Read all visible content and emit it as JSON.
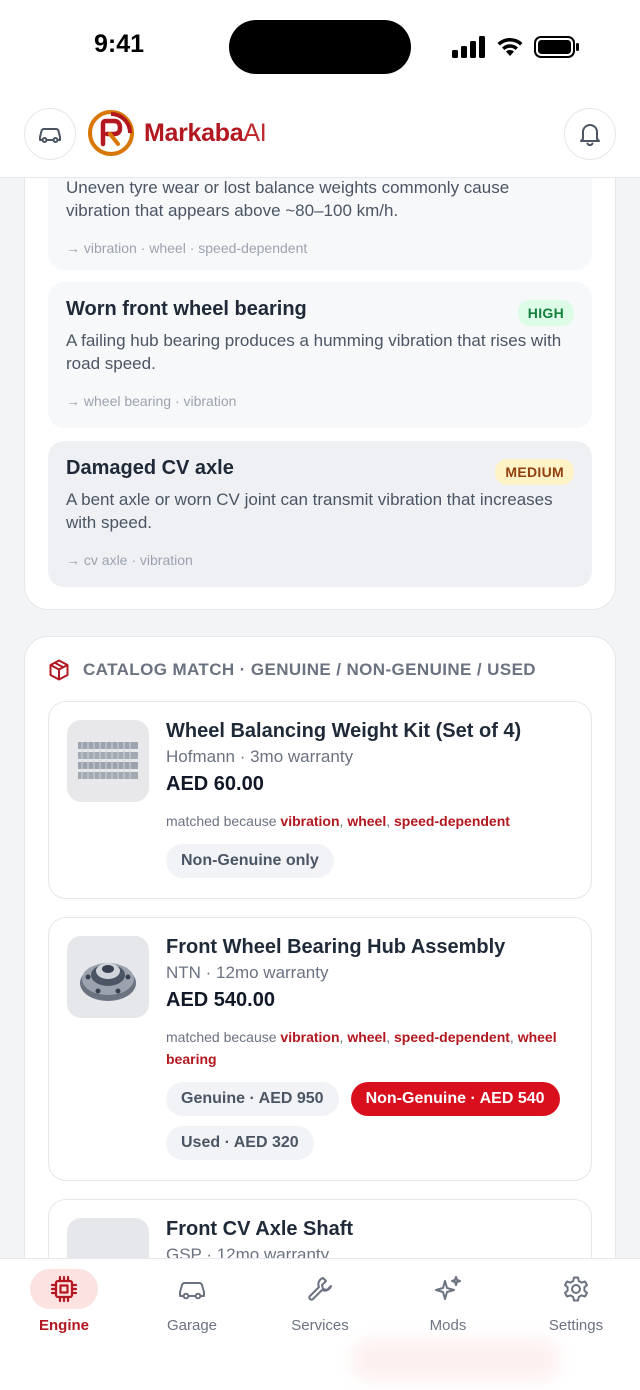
{
  "status_bar": {
    "time": "9:41"
  },
  "header": {
    "logo_main": "Markaba",
    "logo_ai": "AI"
  },
  "causes": [
    {
      "title": "",
      "description": "Uneven tyre wear or lost balance weights commonly cause vibration that appears above ~80–100 km/h.",
      "tags": "→ vibration · wheel · speed-dependent"
    },
    {
      "title": "Worn front wheel bearing",
      "severity": "HIGH",
      "severity_color": "#15803d",
      "severity_bg": "#dcfce7",
      "description": "A failing hub bearing produces a humming vibration that rises with road speed.",
      "tags": "→ wheel bearing · vibration"
    },
    {
      "title": "Damaged CV axle",
      "severity": "MEDIUM",
      "severity_color": "#92400e",
      "severity_bg": "#fef3c7",
      "description": "A bent axle or worn CV joint can transmit vibration that increases with speed.",
      "tags": "→ cv axle · vibration"
    }
  ],
  "catalog": {
    "heading": "CATALOG MATCH · GENUINE / NON-GENUINE / USED",
    "matched_prefix": "matched because",
    "parts": [
      {
        "name": "Wheel Balancing Weight Kit (Set of 4)",
        "meta": "Hofmann · 3mo warranty",
        "price": "AED 60.00",
        "keywords": [
          "vibration",
          "wheel",
          "speed-dependent"
        ],
        "chips": [
          {
            "label": "Non-Genuine only",
            "active": false
          }
        ]
      },
      {
        "name": "Front Wheel Bearing Hub Assembly",
        "meta": "NTN · 12mo warranty",
        "price": "AED 540.00",
        "keywords": [
          "vibration",
          "wheel",
          "speed-dependent",
          "wheel bearing"
        ],
        "chips": [
          {
            "label": "Genuine · AED 950",
            "active": false
          },
          {
            "label": "Non-Genuine · AED 540",
            "active": true
          },
          {
            "label": "Used · AED 320",
            "active": false
          }
        ]
      },
      {
        "name": "Front CV Axle Shaft",
        "meta": "GSP · 12mo warranty"
      }
    ]
  },
  "tabs": [
    {
      "label": "Engine",
      "icon": "chip-icon",
      "active": true
    },
    {
      "label": "Garage",
      "icon": "car-icon",
      "active": false
    },
    {
      "label": "Services",
      "icon": "wrench-icon",
      "active": false
    },
    {
      "label": "Mods",
      "icon": "sparkles-icon",
      "active": false
    },
    {
      "label": "Settings",
      "icon": "gear-icon",
      "active": false
    }
  ],
  "colors": {
    "brand": "#b3171f",
    "accent": "#d90f1e"
  }
}
